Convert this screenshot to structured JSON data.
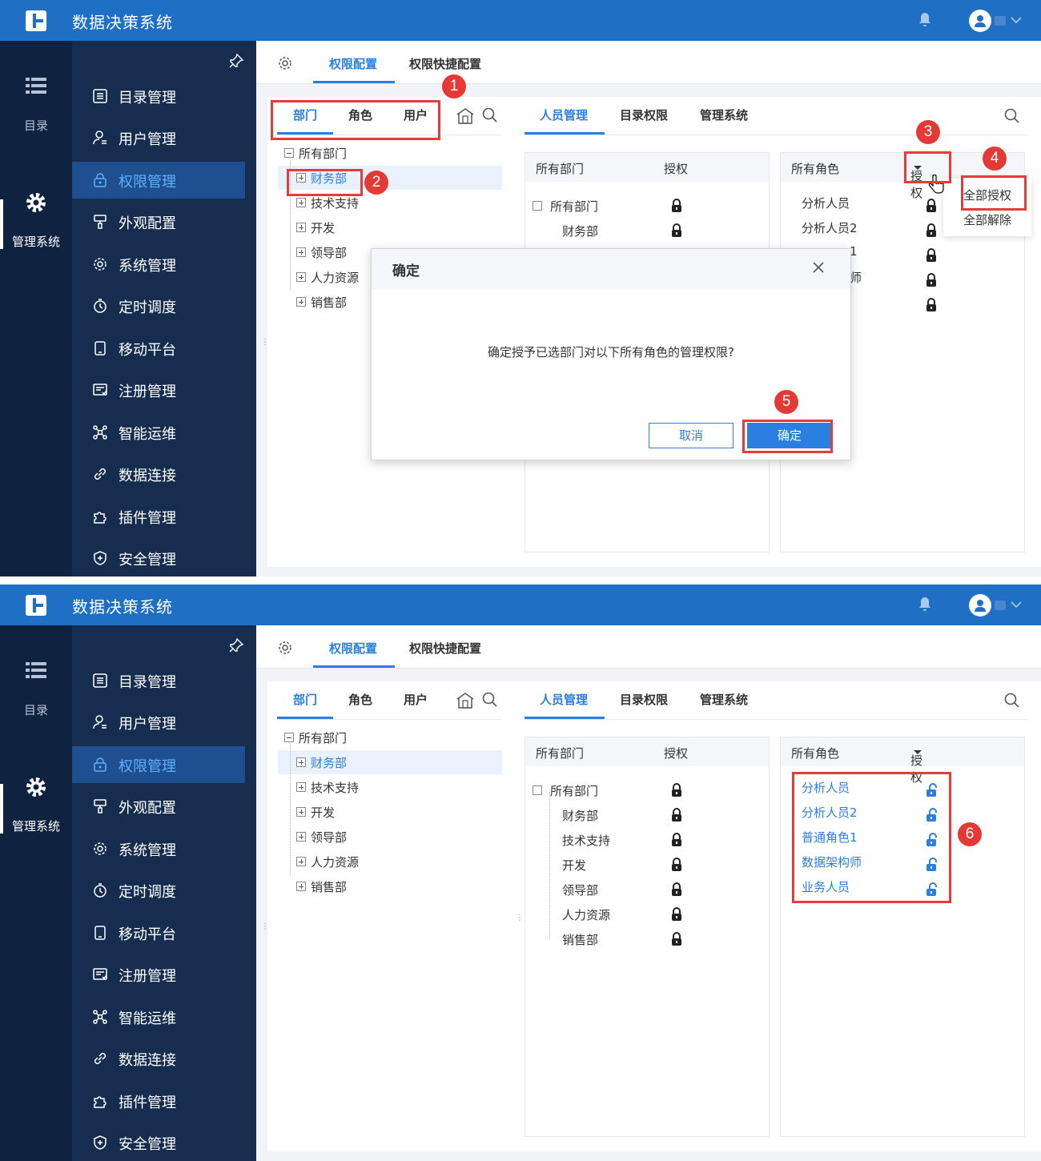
{
  "app": {
    "title": "数据决策系统"
  },
  "rail": {
    "directory": "目录",
    "admin": "管理系统"
  },
  "menu": {
    "items": [
      "目录管理",
      "用户管理",
      "权限管理",
      "外观配置",
      "系统管理",
      "定时调度",
      "移动平台",
      "注册管理",
      "智能运维",
      "数据连接",
      "插件管理",
      "安全管理"
    ],
    "active_index": 2
  },
  "top_tabs": [
    "权限配置",
    "权限快捷配置"
  ],
  "left_tabs": [
    "部门",
    "角色",
    "用户"
  ],
  "tree": {
    "root": "所有部门",
    "children": [
      "财务部",
      "技术支持",
      "开发",
      "领导部",
      "人力资源",
      "销售部"
    ],
    "selected": "财务部"
  },
  "right_tabs": [
    "人员管理",
    "目录权限",
    "管理系统"
  ],
  "dept_column": {
    "header": "所有部门",
    "auth_header": "授权"
  },
  "role_column": {
    "header": "所有角色",
    "auth_header": "授权"
  },
  "roles": [
    "分析人员",
    "分析人员2",
    "普通角色1",
    "数据架构师",
    "业务人员"
  ],
  "screen1": {
    "dept_rows": [
      "所有部门",
      "财务部"
    ],
    "role_rows_visible": [
      "分析人员",
      "分析人员2",
      "1",
      "师",
      ""
    ],
    "dropdown": [
      "全部授权",
      "全部解除"
    ],
    "dialog": {
      "title": "确定",
      "message": "确定授予已选部门对以下所有角色的管理权限?",
      "cancel": "取消",
      "ok": "确定"
    },
    "badges": [
      "1",
      "2",
      "3",
      "4",
      "5"
    ]
  },
  "screen2": {
    "dept_rows": [
      "所有部门",
      "财务部",
      "技术支持",
      "开发",
      "领导部",
      "人力资源",
      "销售部"
    ],
    "role_state": "unlocked",
    "badges": [
      "6"
    ]
  },
  "colors": {
    "primary": "#1f6fc5",
    "accent": "#2a7fe0",
    "sidebar": "#162d4f",
    "rail": "#0f2240",
    "annotation": "#e23c3c"
  }
}
